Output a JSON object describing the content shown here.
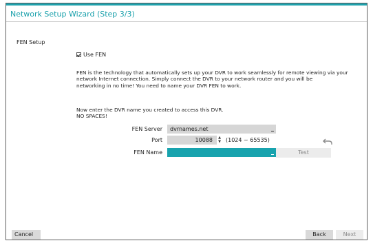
{
  "window": {
    "title": "Network Setup Wizard (Step 3/3)"
  },
  "section": {
    "title": "FEN Setup"
  },
  "use_fen": {
    "label": "Use FEN",
    "checked": true
  },
  "description": {
    "lines": [
      "FEN is the technology that automatically sets up your DVR to work seamlessly for remote viewing via your",
      "network Internet connection. Simply connect the DVR to your network router and you will be",
      "networking in no time! You need to name your DVR FEN to work."
    ]
  },
  "instruction": {
    "lines": [
      "Now enter the DVR name you created to access this DVR.",
      "NO SPACES!"
    ]
  },
  "form": {
    "fen_server": {
      "label": "FEN Server",
      "value": "dvrnames.net"
    },
    "port": {
      "label": "Port",
      "value": "10088",
      "range": "(1024 ~ 65535)"
    },
    "fen_name": {
      "label": "FEN Name",
      "value": ""
    },
    "test_label": "Test"
  },
  "footer": {
    "cancel_label": "Cancel",
    "back_label": "Back",
    "next_label": "Next"
  },
  "colors": {
    "accent": "#1fa2ad",
    "field_bg": "#d6d6d6",
    "button_bg": "#d9d9d9"
  },
  "icons": {
    "spinner": "up-down-spinner-icon",
    "undo": "undo-icon",
    "checkbox": "checkbox-checked-icon"
  }
}
